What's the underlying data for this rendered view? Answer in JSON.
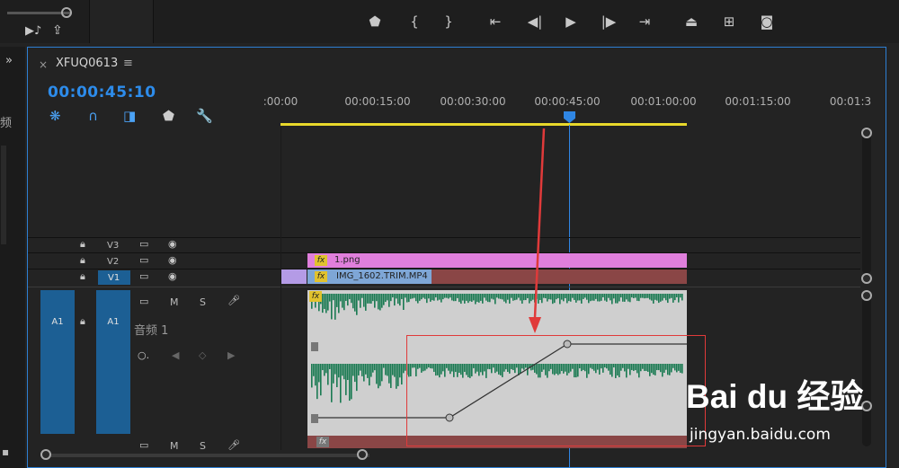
{
  "window": {
    "sequence_tab": "XFUQ0613",
    "timecode": "00:00:45:10"
  },
  "ruler": {
    "ticks": [
      ":00:00",
      "00:00:15:00",
      "00:00:30:00",
      "00:00:45:00",
      "00:01:00:00",
      "00:01:15:00",
      "00:01:3"
    ]
  },
  "tracks": {
    "video": [
      {
        "label": "V3"
      },
      {
        "label": "V2"
      },
      {
        "label": "V1"
      }
    ],
    "audio": {
      "label": "A1",
      "source_label": "A1",
      "name": "音频 1",
      "buttons": [
        "M",
        "S"
      ],
      "lower_buttons": [
        "M",
        "S"
      ]
    }
  },
  "clips": {
    "v2": {
      "name": "1.png",
      "color": "#e07fdc"
    },
    "v1": {
      "name": "IMG_1602.TRIM.MP4",
      "color": "#7ea6d6"
    },
    "fx_label": "fx"
  },
  "left_panel": {
    "glyph": "频"
  },
  "watermark": {
    "logo": "Bai du 经验",
    "url": "jingyan.baidu.com"
  },
  "icons": {
    "marker": "marker-icon",
    "in_point": "in-point-icon",
    "out_point": "out-point-icon",
    "goto_in": "go-to-in-icon",
    "step_back": "step-back-icon",
    "play": "play-icon",
    "step_forward": "step-forward-icon",
    "goto_out": "go-to-out-icon",
    "lift": "lift-icon",
    "extract": "extract-icon",
    "camera": "export-frame-icon"
  },
  "colors": {
    "accent_blue": "#2d8ceb",
    "work_area": "#e8d82b",
    "waveform": "#1a7a52",
    "annotation": "#e03a3a"
  }
}
